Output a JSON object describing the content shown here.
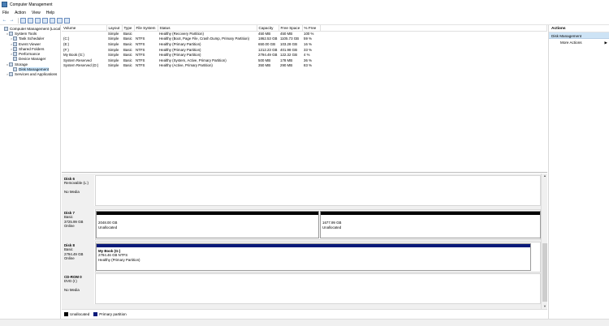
{
  "window": {
    "title": "Computer Management"
  },
  "menu": [
    "File",
    "Action",
    "View",
    "Help"
  ],
  "tree": [
    {
      "label": "Computer Management (Local",
      "indent": 0,
      "exp": ""
    },
    {
      "label": "System Tools",
      "indent": 1,
      "exp": "v"
    },
    {
      "label": "Task Scheduler",
      "indent": 2,
      "exp": ">"
    },
    {
      "label": "Event Viewer",
      "indent": 2,
      "exp": ">"
    },
    {
      "label": "Shared Folders",
      "indent": 2,
      "exp": ">"
    },
    {
      "label": "Performance",
      "indent": 2,
      "exp": ">"
    },
    {
      "label": "Device Manager",
      "indent": 2,
      "exp": ""
    },
    {
      "label": "Storage",
      "indent": 1,
      "exp": "v"
    },
    {
      "label": "Disk Management",
      "indent": 2,
      "exp": "",
      "selected": true
    },
    {
      "label": "Services and Applications",
      "indent": 1,
      "exp": ">"
    }
  ],
  "volumes": {
    "columns": [
      "Volume",
      "Layout",
      "Type",
      "File System",
      "Status",
      "Capacity",
      "Free Space",
      "% Free"
    ],
    "rows": [
      [
        "",
        "Simple",
        "Basic",
        "",
        "Healthy (Recovery Partition)",
        "450 MB",
        "450 MB",
        "100 %"
      ],
      [
        "(C:)",
        "Simple",
        "Basic",
        "NTFS",
        "Healthy (Boot, Page File, Crash Dump, Primary Partition)",
        "1862.53 GB",
        "1105.73 GB",
        "59 %"
      ],
      [
        "(E:)",
        "Simple",
        "Basic",
        "NTFS",
        "Healthy (Primary Partition)",
        "650.00 GB",
        "103.28 GB",
        "16 %"
      ],
      [
        "(F:)",
        "Simple",
        "Basic",
        "NTFS",
        "Healthy (Primary Partition)",
        "1212.23 GB",
        "401.98 GB",
        "33 %"
      ],
      [
        "My Book (G:)",
        "Simple",
        "Basic",
        "NTFS",
        "Healthy (Primary Partition)",
        "2794.49 GB",
        "122.32 GB",
        "4 %"
      ],
      [
        "System Reserved",
        "Simple",
        "Basic",
        "NTFS",
        "Healthy (System, Active, Primary Partition)",
        "500 MB",
        "178 MB",
        "36 %"
      ],
      [
        "System Reserved (D:)",
        "Simple",
        "Basic",
        "NTFS",
        "Healthy (Active, Primary Partition)",
        "350 MB",
        "290 MB",
        "83 %"
      ]
    ]
  },
  "disks": [
    {
      "name": "Disk 6",
      "lines": [
        "Removable (L:)",
        "",
        "No Media"
      ]
    },
    {
      "name": "Disk 7",
      "lines": [
        "Basic",
        "3725.99 GB",
        "Online"
      ],
      "parts": [
        {
          "size": "2048.00 GB",
          "status": "Unallocated",
          "kind": "unallocated"
        },
        {
          "size": "1677.99 GB",
          "status": "Unallocated",
          "kind": "unallocated"
        }
      ]
    },
    {
      "name": "Disk 8",
      "lines": [
        "Basic",
        "2794.49 GB",
        "Online"
      ],
      "parts": [
        {
          "title": "My Book  (G:)",
          "size": "2794.46 GB NTFS",
          "status": "Healthy (Primary Partition)",
          "kind": "primary"
        }
      ]
    },
    {
      "name": "CD-ROM 0",
      "lines": [
        "DVD (I:)",
        "",
        "No Media"
      ]
    }
  ],
  "legend": [
    {
      "label": "Unallocated",
      "color": "#000000"
    },
    {
      "label": "Primary partition",
      "color": "#0a1a7a"
    }
  ],
  "actions": {
    "header": "Actions",
    "selected": "Disk Management",
    "more": "More Actions",
    "more_arrow": "▶"
  }
}
